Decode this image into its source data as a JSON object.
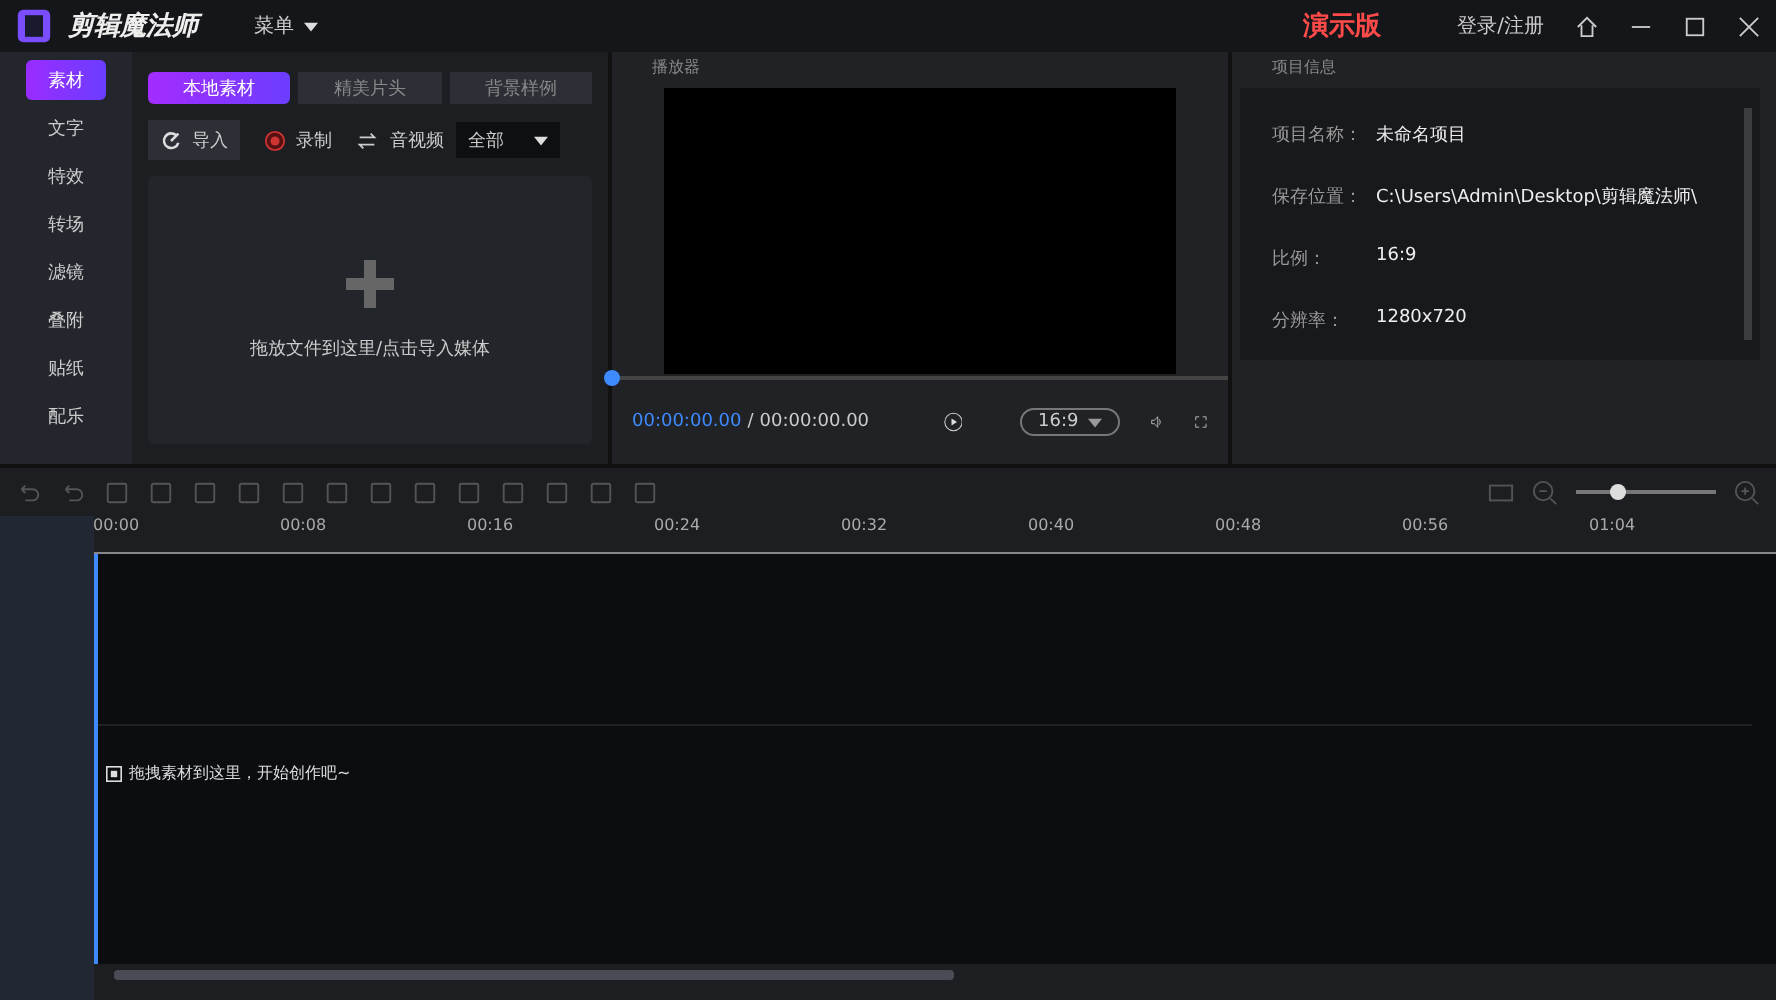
{
  "app": {
    "title": "剪辑魔法师",
    "menu": "菜单",
    "badge": "演示版",
    "login": "登录/注册"
  },
  "sidebar": {
    "items": [
      {
        "label": "素材",
        "selected": true
      },
      {
        "label": "文字",
        "selected": false
      },
      {
        "label": "特效",
        "selected": false
      },
      {
        "label": "转场",
        "selected": false
      },
      {
        "label": "滤镜",
        "selected": false
      },
      {
        "label": "叠附",
        "selected": false
      },
      {
        "label": "贴纸",
        "selected": false
      },
      {
        "label": "配乐",
        "selected": false
      }
    ]
  },
  "media": {
    "tabs": [
      {
        "label": "本地素材",
        "selected": true
      },
      {
        "label": "精美片头",
        "selected": false
      },
      {
        "label": "背景样例",
        "selected": false
      }
    ],
    "import": "导入",
    "record": "录制",
    "filter_label": "音视频",
    "filter_value": "全部",
    "drop_hint": "拖放文件到这里/点击导入媒体"
  },
  "player": {
    "title": "播放器",
    "current": "00:00:00.00",
    "separator": "/",
    "total": "00:00:00.00",
    "ratio": "16:9",
    "level": 0
  },
  "project": {
    "title": "项目信息",
    "rows": [
      {
        "label": "项目名称：",
        "value": "未命名项目"
      },
      {
        "label": "保存位置：",
        "value": "C:\\Users\\Admin\\Desktop\\剪辑魔法师\\"
      },
      {
        "label": "比例：",
        "value": "16:9"
      },
      {
        "label": "分辨率：",
        "value": "1280x720"
      }
    ]
  },
  "timeline": {
    "zoom": {
      "level": 0.3
    },
    "ticks": [
      "00:00",
      "00:08",
      "00:16",
      "00:24",
      "00:32",
      "00:40",
      "00:48",
      "00:56",
      "01:04"
    ],
    "hint": "拖拽素材到这里，开始创作吧~"
  }
}
